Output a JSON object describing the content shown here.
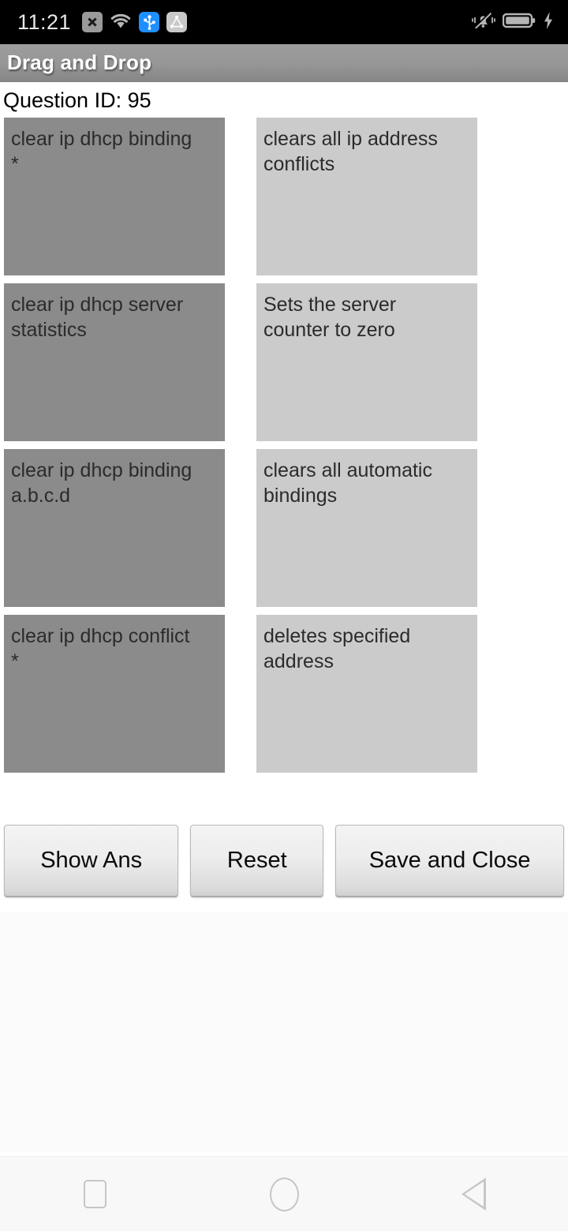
{
  "status_bar": {
    "clock": "11:21",
    "left_icons": [
      {
        "name": "sim-disabled-icon",
        "glyph": "x"
      },
      {
        "name": "wifi-icon",
        "glyph": "wifi"
      },
      {
        "name": "usb-icon",
        "glyph": "usb"
      },
      {
        "name": "adb-debug-icon",
        "glyph": "adb"
      }
    ],
    "right_icons": [
      {
        "name": "vibrate-mute-icon",
        "glyph": "bell-slash"
      },
      {
        "name": "battery-icon",
        "glyph": "battery"
      },
      {
        "name": "charging-bolt-icon",
        "glyph": "bolt"
      }
    ],
    "background": "#000000"
  },
  "app_bar": {
    "title": "Drag and Drop",
    "background": "#969696",
    "title_color": "#ffffff"
  },
  "question": {
    "label": "Question ID: 95"
  },
  "colors": {
    "term_tile": "#8b8b8b",
    "definition_tile": "#cbcbcb",
    "page_background": "#ffffff",
    "lower_pane": "#fbfbfb",
    "nav_bar": "#f8f8f8",
    "nav_icon": "#c6c6c6"
  },
  "dnd": {
    "rows": [
      {
        "term": "clear ip dhcp binding\n*",
        "definition": "clears all ip address\nconflicts"
      },
      {
        "term": "clear ip dhcp server\nstatistics",
        "definition": "Sets the server\ncounter to zero"
      },
      {
        "term": "clear ip dhcp binding\na.b.c.d",
        "definition": "clears all automatic\nbindings"
      },
      {
        "term": "clear ip dhcp conflict\n*",
        "definition": "deletes specified\naddress"
      }
    ]
  },
  "buttons": {
    "show_answer": "Show Ans",
    "reset": "Reset",
    "save_and_close": "Save and Close"
  },
  "nav_bar": {
    "recents": "recents",
    "home": "home",
    "back": "back"
  }
}
